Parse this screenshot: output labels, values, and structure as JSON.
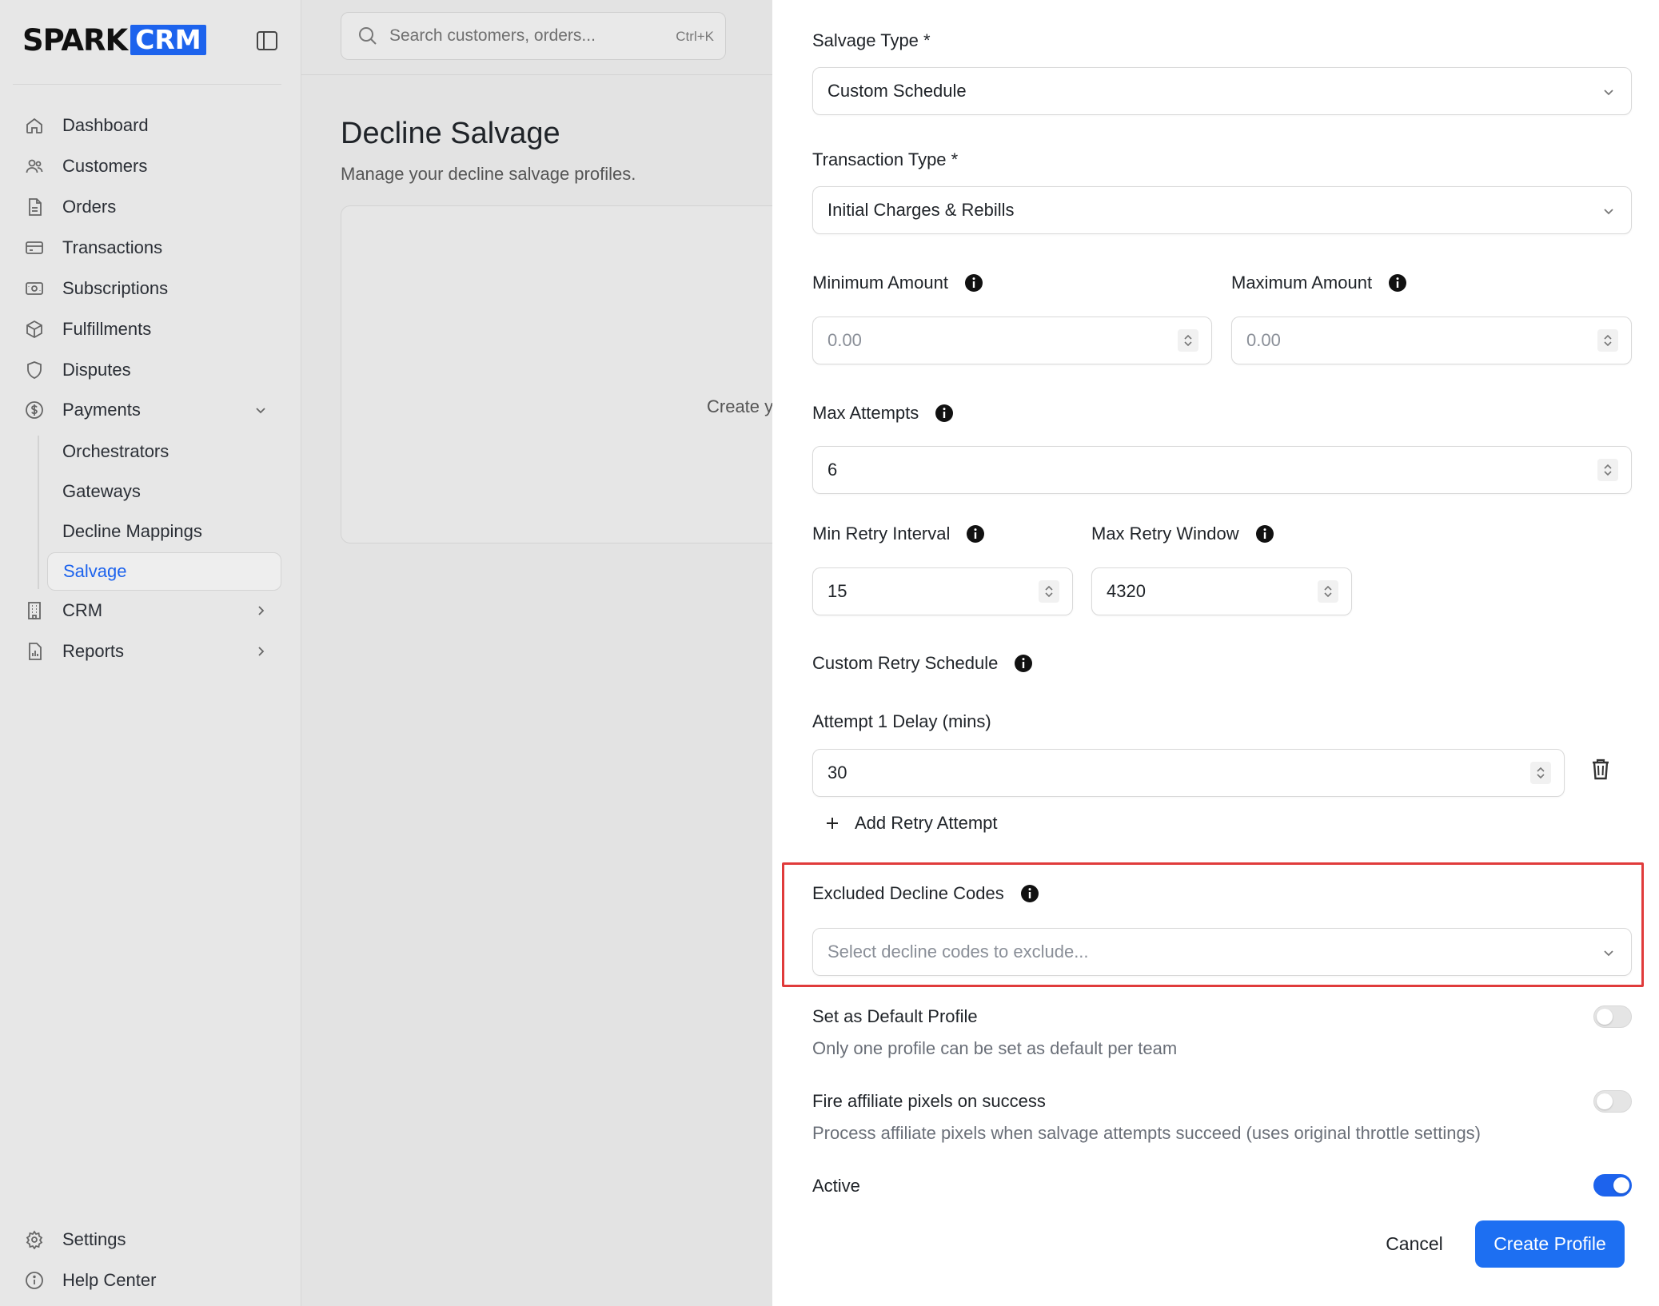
{
  "brand": {
    "name_part1": "SPARK",
    "name_part2": "CRM"
  },
  "search": {
    "placeholder": "Search customers, orders...",
    "shortcut": "Ctrl+K"
  },
  "sidebar": {
    "items": [
      {
        "label": "Dashboard",
        "icon": "home-icon"
      },
      {
        "label": "Customers",
        "icon": "users-icon"
      },
      {
        "label": "Orders",
        "icon": "document-icon"
      },
      {
        "label": "Transactions",
        "icon": "credit-card-icon"
      },
      {
        "label": "Subscriptions",
        "icon": "money-icon"
      },
      {
        "label": "Fulfillments",
        "icon": "box-icon"
      },
      {
        "label": "Disputes",
        "icon": "shield-icon"
      },
      {
        "label": "Payments",
        "icon": "dollar-circle-icon",
        "expanded": true
      },
      {
        "label": "CRM",
        "icon": "building-icon"
      },
      {
        "label": "Reports",
        "icon": "report-icon"
      }
    ],
    "payments_sub": [
      {
        "label": "Orchestrators"
      },
      {
        "label": "Gateways"
      },
      {
        "label": "Decline Mappings"
      },
      {
        "label": "Salvage",
        "active": true
      }
    ],
    "footer": [
      {
        "label": "Settings",
        "icon": "gear-icon"
      },
      {
        "label": "Help Center",
        "icon": "info-circle-icon"
      }
    ]
  },
  "page": {
    "title": "Decline Salvage",
    "subtitle": "Manage your decline salvage profiles.",
    "empty_text": "Create y"
  },
  "form": {
    "salvage_type": {
      "label": "Salvage Type *",
      "value": "Custom Schedule"
    },
    "transaction_type": {
      "label": "Transaction Type *",
      "value": "Initial Charges & Rebills"
    },
    "min_amount": {
      "label": "Minimum Amount",
      "placeholder": "0.00"
    },
    "max_amount": {
      "label": "Maximum Amount",
      "placeholder": "0.00"
    },
    "max_attempts": {
      "label": "Max Attempts",
      "value": "6"
    },
    "min_retry_interval": {
      "label": "Min Retry Interval",
      "value": "15"
    },
    "max_retry_window": {
      "label": "Max Retry Window",
      "value": "4320"
    },
    "custom_schedule": {
      "label": "Custom Retry Schedule"
    },
    "attempt1": {
      "label": "Attempt 1 Delay (mins)",
      "value": "30"
    },
    "add_retry_label": "Add Retry Attempt",
    "excluded_codes": {
      "label": "Excluded Decline Codes",
      "placeholder": "Select decline codes to exclude..."
    },
    "default_profile": {
      "label": "Set as Default Profile",
      "description": "Only one profile can be set as default per team",
      "on": false
    },
    "fire_pixels": {
      "label": "Fire affiliate pixels on success",
      "description": "Process affiliate pixels when salvage attempts succeed (uses original throttle settings)",
      "on": false
    },
    "active": {
      "label": "Active",
      "on": true
    },
    "cancel_label": "Cancel",
    "create_label": "Create Profile"
  },
  "colors": {
    "accent": "#1d63ed",
    "highlight": "#e03b3b"
  }
}
